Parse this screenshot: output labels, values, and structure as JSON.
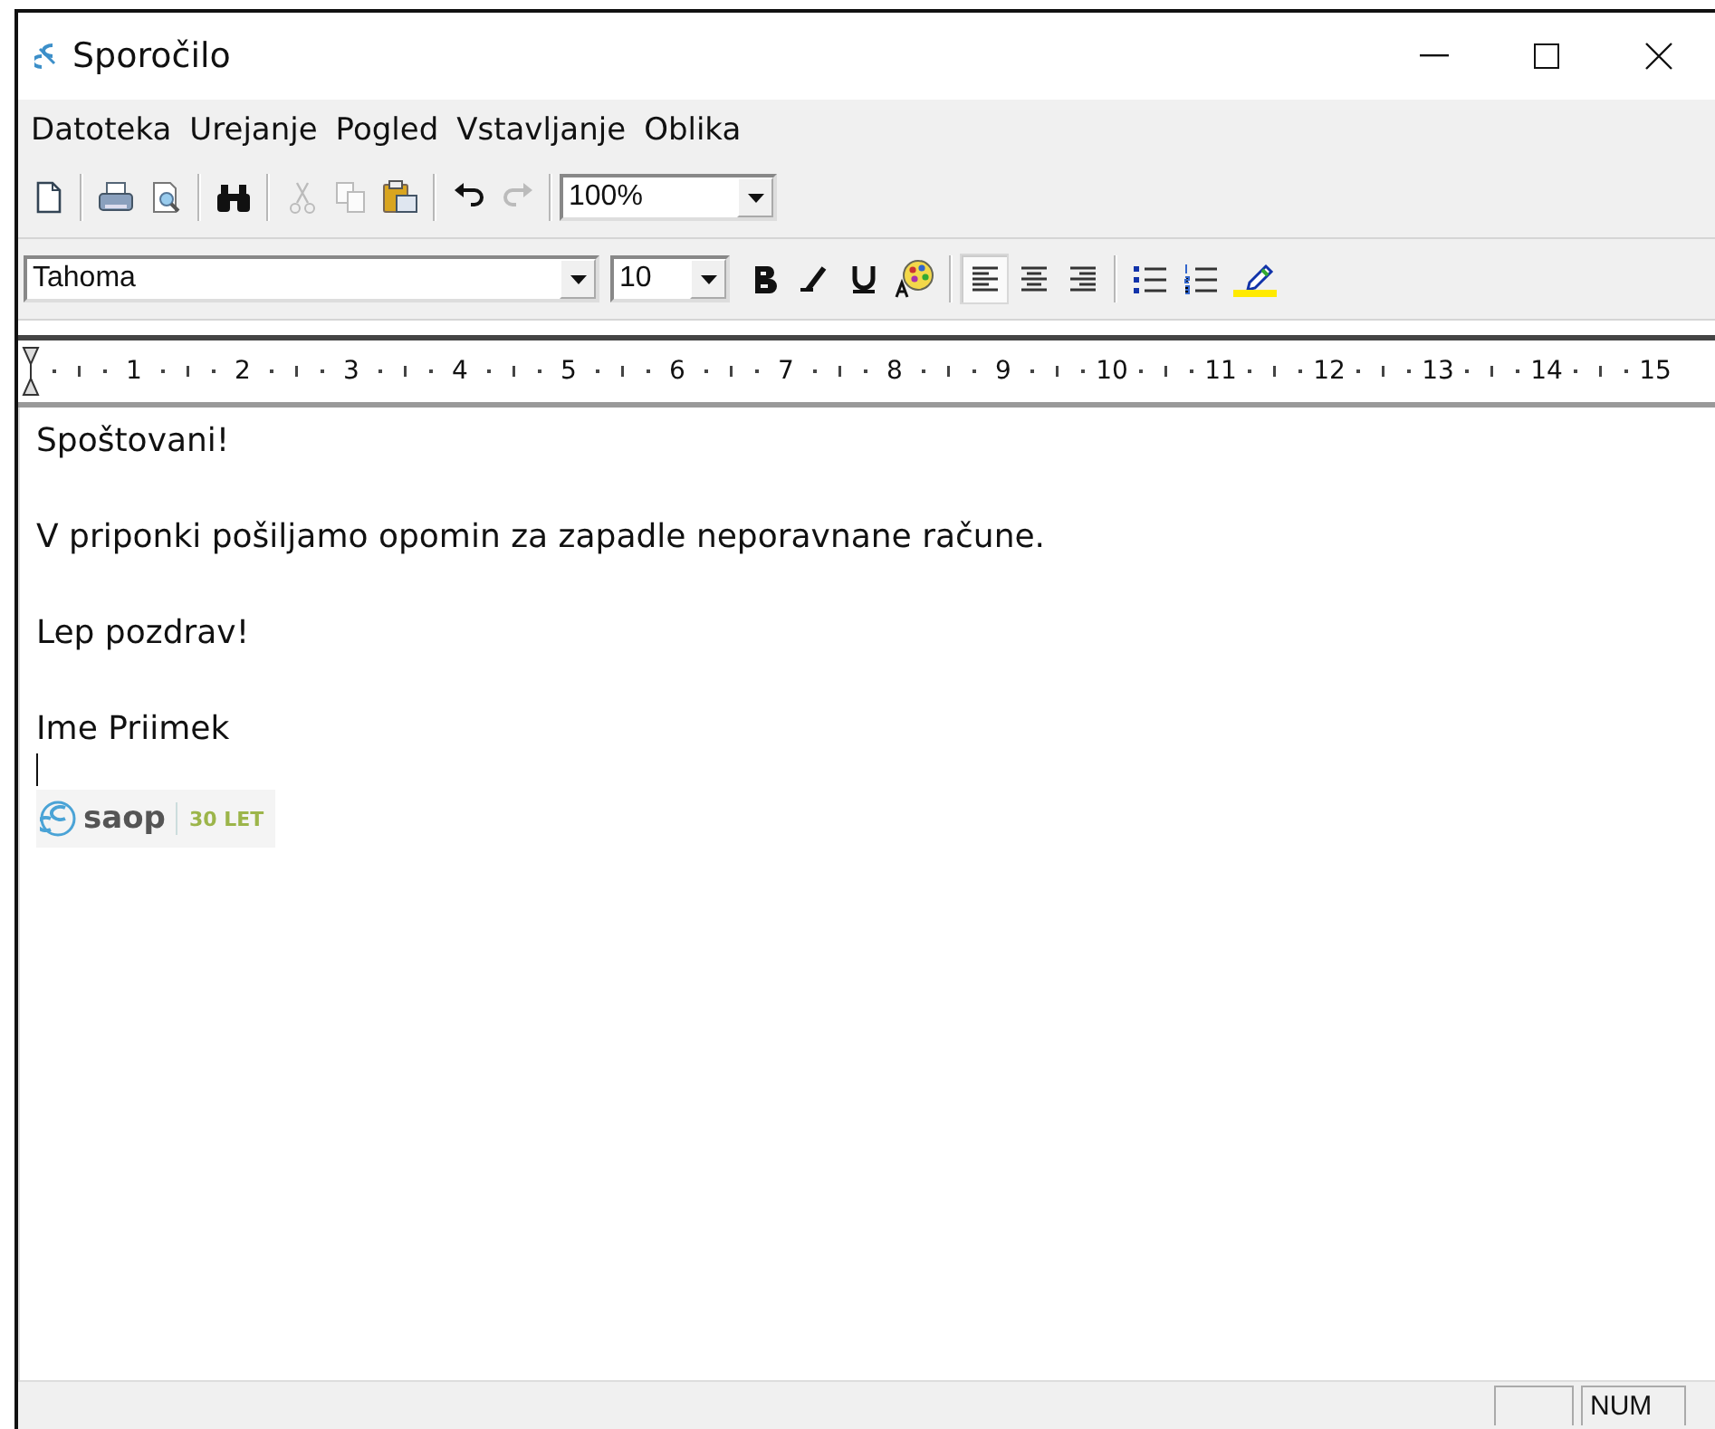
{
  "window": {
    "title": "Sporočilo"
  },
  "menu": [
    {
      "label": "Datoteka"
    },
    {
      "label": "Urejanje"
    },
    {
      "label": "Pogled"
    },
    {
      "label": "Vstavljanje"
    },
    {
      "label": "Oblika"
    }
  ],
  "toolbar": [
    {
      "kind": "new",
      "disabled": false
    },
    {
      "kind": "separator"
    },
    {
      "kind": "print",
      "disabled": false
    },
    {
      "kind": "preview",
      "disabled": false
    },
    {
      "kind": "separator"
    },
    {
      "kind": "find",
      "disabled": false
    },
    {
      "kind": "separator"
    },
    {
      "kind": "cut",
      "disabled": true
    },
    {
      "kind": "copy",
      "disabled": true
    },
    {
      "kind": "paste",
      "disabled": false
    },
    {
      "kind": "separator"
    },
    {
      "kind": "undo",
      "disabled": false
    },
    {
      "kind": "redo",
      "disabled": true
    },
    {
      "kind": "separator"
    }
  ],
  "zoom": {
    "value": "100%"
  },
  "format_bar": {
    "font": "Tahoma",
    "size": "10",
    "buttons": [
      {
        "kind": "bold",
        "selected": false
      },
      {
        "kind": "italic",
        "selected": false
      },
      {
        "kind": "underline",
        "selected": false
      },
      {
        "kind": "color",
        "selected": false
      },
      {
        "kind": "separator"
      },
      {
        "kind": "align-left",
        "selected": true
      },
      {
        "kind": "align-center",
        "selected": false
      },
      {
        "kind": "align-right",
        "selected": false
      },
      {
        "kind": "separator"
      },
      {
        "kind": "bullets",
        "selected": false
      },
      {
        "kind": "numbering",
        "selected": false
      },
      {
        "kind": "highlight",
        "selected": false
      }
    ]
  },
  "ruler": {
    "labels": [
      "1",
      "2",
      "3",
      "4",
      "5",
      "6",
      "7",
      "8",
      "9",
      "10",
      "11",
      "12",
      "13",
      "14",
      "15"
    ]
  },
  "body": {
    "paragraphs": [
      "Spoštovani!",
      "V priponki pošiljamo opomin za zapadle neporavnane račune.",
      "Lep pozdrav!",
      "Ime Priimek"
    ],
    "signature_logo": {
      "name": "saop",
      "tagline": "30 LET"
    }
  },
  "status_bar": {
    "indicator": "NUM"
  }
}
